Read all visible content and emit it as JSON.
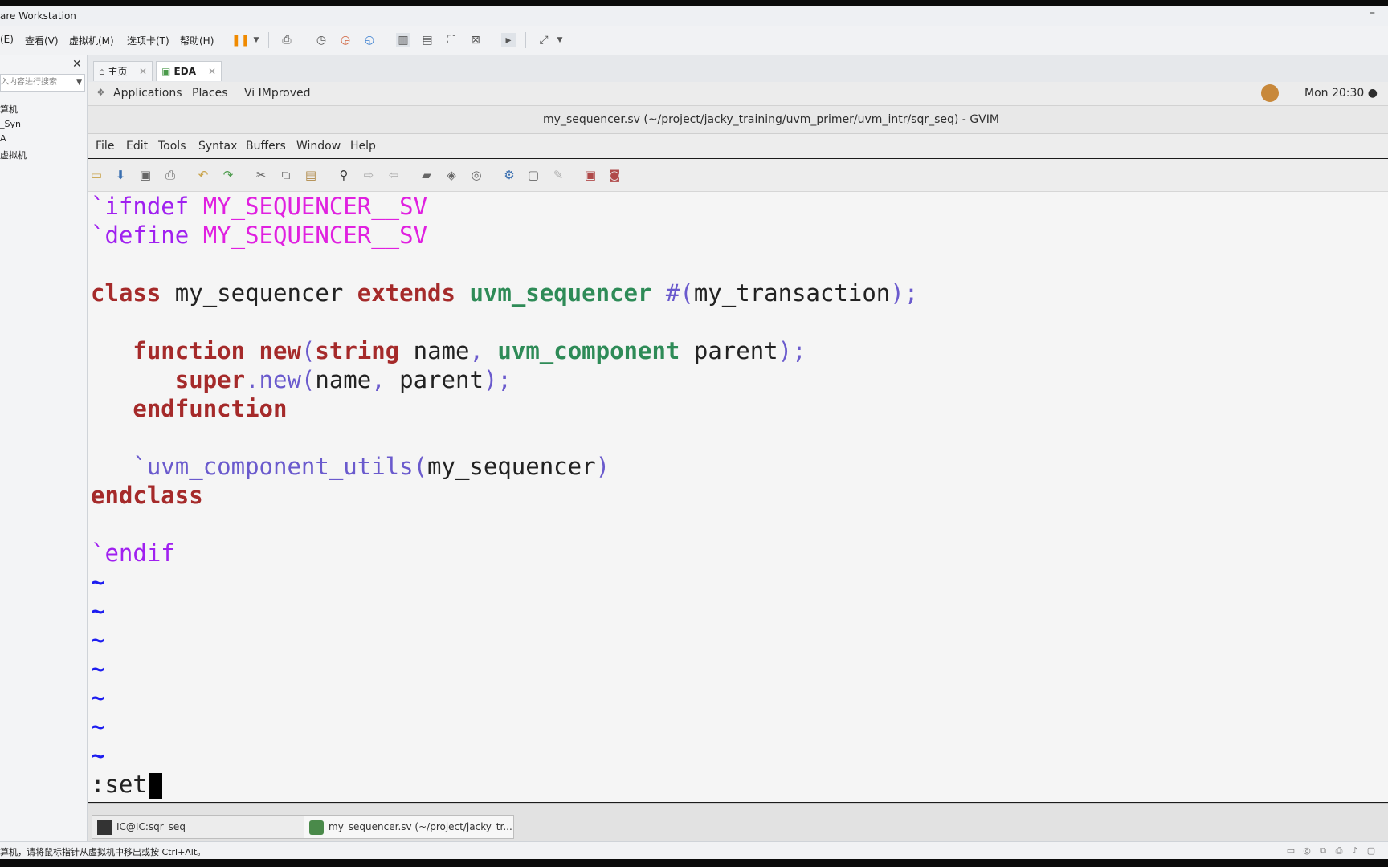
{
  "vmware": {
    "title": "are Workstation",
    "minimize": "–",
    "menu": [
      "(E)",
      "查看(V)",
      "虚拟机(M)",
      "选项卡(T)",
      "帮助(H)"
    ]
  },
  "library": {
    "close": "✕",
    "search_placeholder": "入内容进行搜索",
    "items": [
      "算机",
      "_Syn",
      "A",
      "虚拟机"
    ]
  },
  "tabs": [
    {
      "label": "主页",
      "icon": "home-icon"
    },
    {
      "label": "EDA",
      "icon": "vm-icon"
    }
  ],
  "gnome": {
    "applications": "Applications",
    "places": "Places",
    "app_name": "Vi IMproved",
    "clock": "Mon 20:30 ●"
  },
  "gvim": {
    "title": "my_sequencer.sv (~/project/jacky_training/uvm_primer/uvm_intr/sqr_seq) - GVIM",
    "menu": [
      "File",
      "Edit",
      "Tools",
      "Syntax",
      "Buffers",
      "Window",
      "Help"
    ]
  },
  "editor": {
    "command": ":set",
    "tilde": "~",
    "lines": [
      [
        [
          "pp",
          "`ifndef "
        ],
        [
          "mg",
          "MY_SEQUENCER__SV"
        ]
      ],
      [
        [
          "pp",
          "`define "
        ],
        [
          "mg",
          "MY_SEQUENCER__SV"
        ]
      ],
      [],
      [
        [
          "kw",
          "class"
        ],
        [
          "tx",
          " my_sequencer "
        ],
        [
          "kw",
          "extends"
        ],
        [
          "tx",
          " "
        ],
        [
          "ty",
          "uvm_sequencer"
        ],
        [
          "tx",
          " "
        ],
        [
          "pu",
          "#("
        ],
        [
          "tx",
          "my_transaction"
        ],
        [
          "pu",
          ");"
        ]
      ],
      [],
      [
        [
          "tx",
          "   "
        ],
        [
          "kw",
          "function"
        ],
        [
          "tx",
          " "
        ],
        [
          "kw",
          "new"
        ],
        [
          "pu",
          "("
        ],
        [
          "kw",
          "string"
        ],
        [
          "tx",
          " name"
        ],
        [
          "pu",
          ","
        ],
        [
          "tx",
          " "
        ],
        [
          "ty",
          "uvm_component"
        ],
        [
          "tx",
          " parent"
        ],
        [
          "pu",
          ");"
        ]
      ],
      [
        [
          "tx",
          "      "
        ],
        [
          "kw",
          "super"
        ],
        [
          "pu",
          ".new("
        ],
        [
          "tx",
          "name"
        ],
        [
          "pu",
          ","
        ],
        [
          "tx",
          " parent"
        ],
        [
          "pu",
          ");"
        ]
      ],
      [
        [
          "tx",
          "   "
        ],
        [
          "kw",
          "endfunction"
        ]
      ],
      [],
      [
        [
          "tx",
          "   "
        ],
        [
          "pu",
          "`uvm_component_utils("
        ],
        [
          "tx",
          "my_sequencer"
        ],
        [
          "pu",
          ")"
        ]
      ],
      [
        [
          "kw",
          "endclass"
        ]
      ],
      [],
      [
        [
          "pp",
          "`endif"
        ]
      ]
    ]
  },
  "taskbar": [
    {
      "label": "IC@IC:sqr_seq",
      "icon": "terminal-icon"
    },
    {
      "label": "my_sequencer.sv (~/project/jacky_tr...",
      "icon": "gvim-icon"
    }
  ],
  "statusbar": {
    "text": "算机，请将鼠标指针从虚拟机中移出或按 Ctrl+Alt。"
  }
}
